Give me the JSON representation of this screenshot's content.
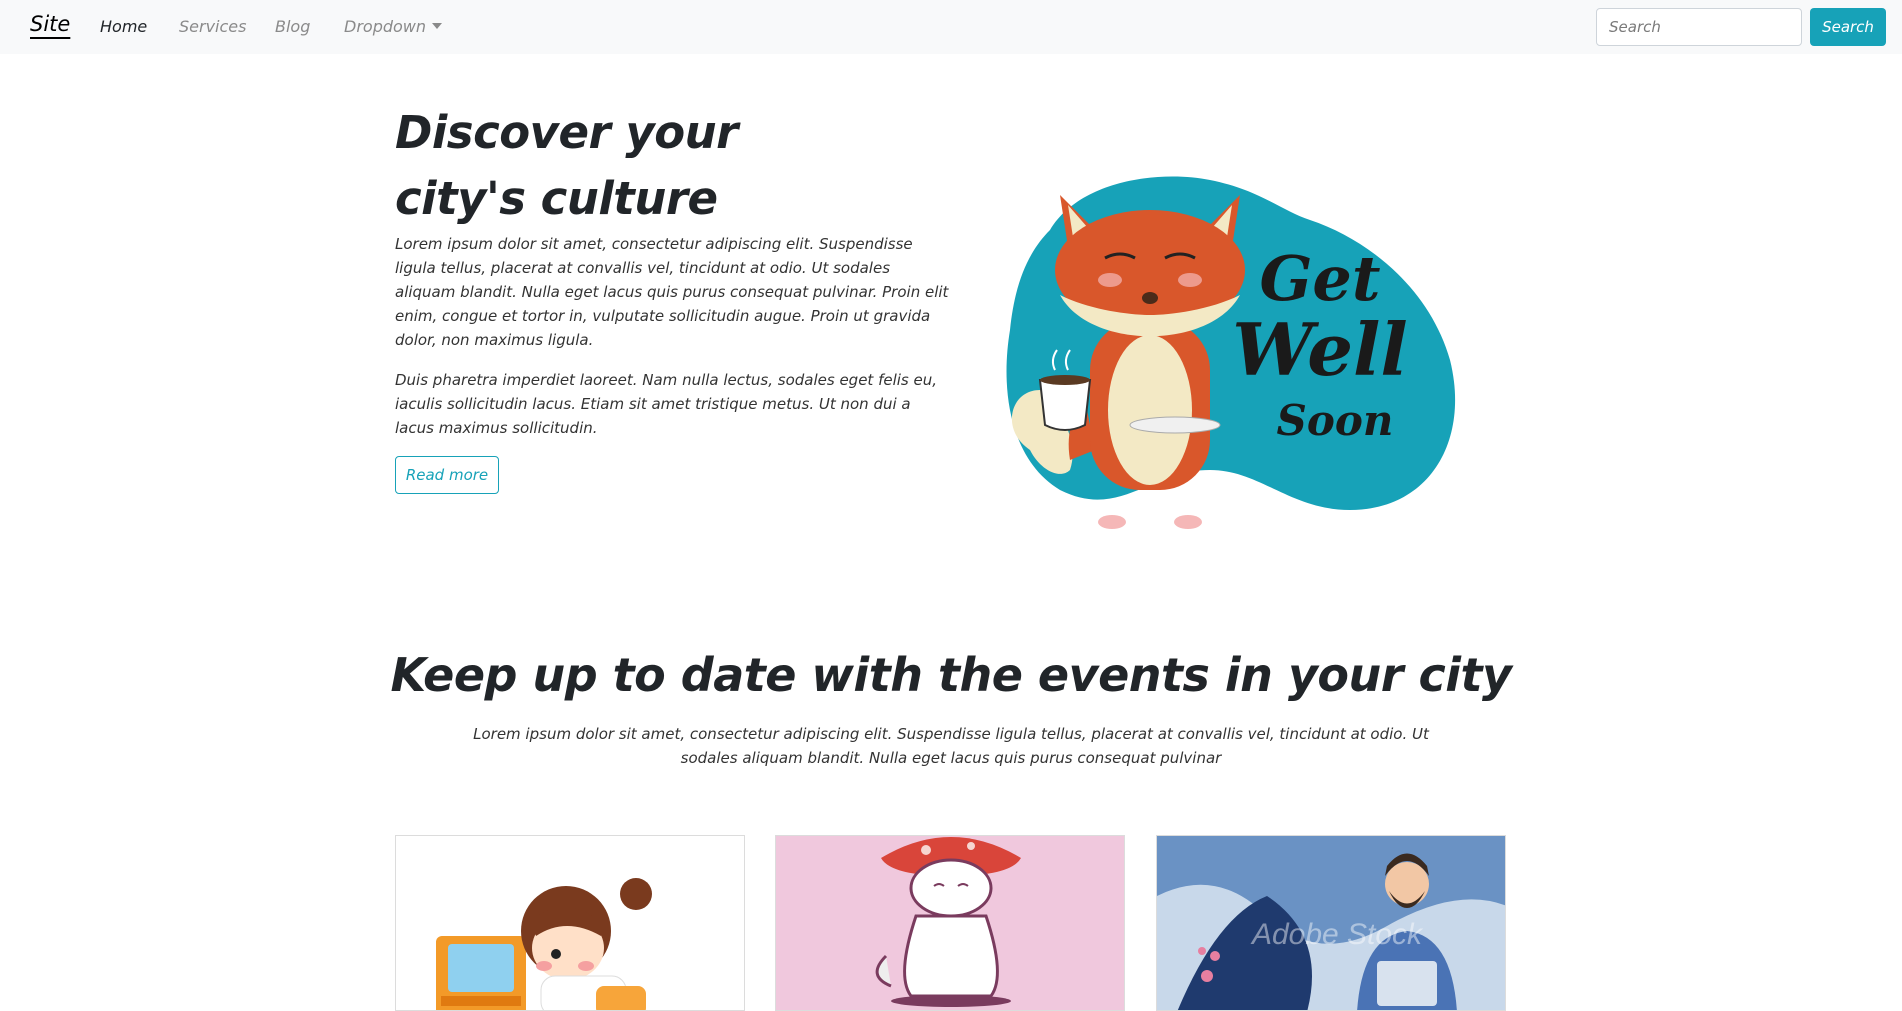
{
  "navbar": {
    "brand": "Site",
    "links": [
      {
        "label": "Home",
        "active": true
      },
      {
        "label": "Services",
        "active": false
      },
      {
        "label": "Blog",
        "active": false
      },
      {
        "label": "Dropdown",
        "active": false
      }
    ],
    "search_placeholder": "Search",
    "search_button": "Search"
  },
  "hero": {
    "title_line1": "Discover your",
    "title_line2": "city's culture",
    "paragraph1": "Lorem ipsum dolor sit amet, consectetur adipiscing elit. Suspendisse ligula tellus, placerat at convallis vel, tincidunt at odio. Ut sodales aliquam blandit. Nulla eget lacus quis purus consequat pulvinar. Proin elit enim, congue et tortor in, vulputate sollicitudin augue. Proin ut gravida dolor, non maximus ligula.",
    "paragraph2": "Duis pharetra imperdiet laoreet. Nam nulla lectus, sodales eget felis eu, iaculis sollicitudin lacus. Etiam sit amet tristique metus. Ut non dui a lacus maximus sollicitudin.",
    "read_more": "Read more",
    "illustration_text": {
      "line1": "Get",
      "line2": "Well",
      "line3": "Soon"
    }
  },
  "events": {
    "title": "Keep up to date with the events in your city",
    "description": "Lorem ipsum dolor sit amet, consectetur adipiscing elit. Suspendisse ligula tellus, placerat at convallis vel, tincidunt at odio. Ut sodales aliquam blandit. Nulla eget lacus quis purus consequat pulvinar",
    "cards": [
      {
        "image": "girl-at-computer-illustration"
      },
      {
        "image": "cat-mushroom-illustration"
      },
      {
        "image": "man-with-laptop-illustration",
        "watermark": "Adobe Stock"
      }
    ]
  },
  "colors": {
    "accent": "#17a2b8",
    "navbar_bg": "#f8f9fa",
    "card2_bg": "#f0c8dd",
    "card3_bg": "#6a92c4"
  }
}
